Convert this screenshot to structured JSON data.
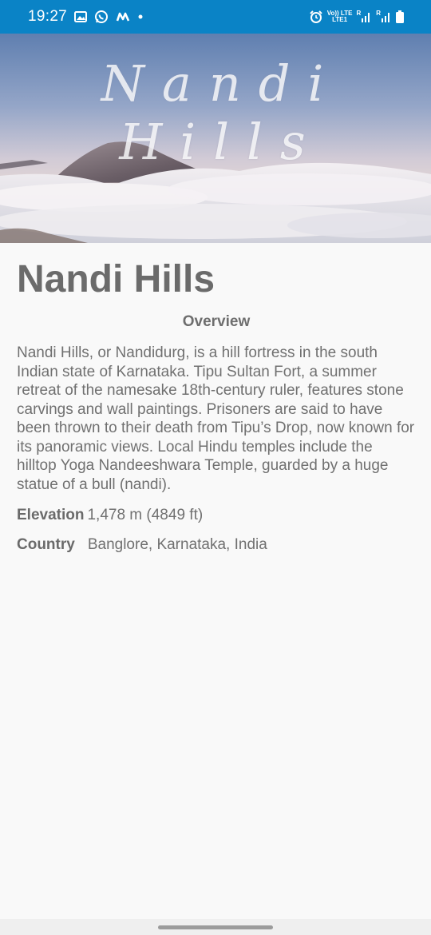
{
  "status_bar": {
    "time": "19:27",
    "network_top": "Vo)) LTE",
    "network_bottom": "LTE1",
    "sim1_label": "R",
    "sim2_label": "R"
  },
  "hero": {
    "title": "Nandi Hills"
  },
  "page": {
    "title": "Nandi Hills",
    "overview_heading": "Overview",
    "description": "Nandi Hills, or Nandidurg, is a hill fortress in the south Indian state of Karnataka. Tipu Sultan Fort, a summer retreat of the namesake 18th-century ruler, features stone carvings and wall paintings. Prisoners are said to have been thrown to their death from Tipu’s Drop, now known for its panoramic views. Local Hindu temples include the hilltop Yoga Nandeeshwara Temple, guarded by a huge statue of a bull (nandi).",
    "elevation_label": "Elevation",
    "elevation_value": "1,478 m (4849 ft)",
    "country_label": "Country",
    "country_value": "Banglore, Karnataka, India"
  },
  "colors": {
    "status_bar": "#0a83c6",
    "background": "#f9f9f9",
    "text": "#6d6d6d"
  }
}
